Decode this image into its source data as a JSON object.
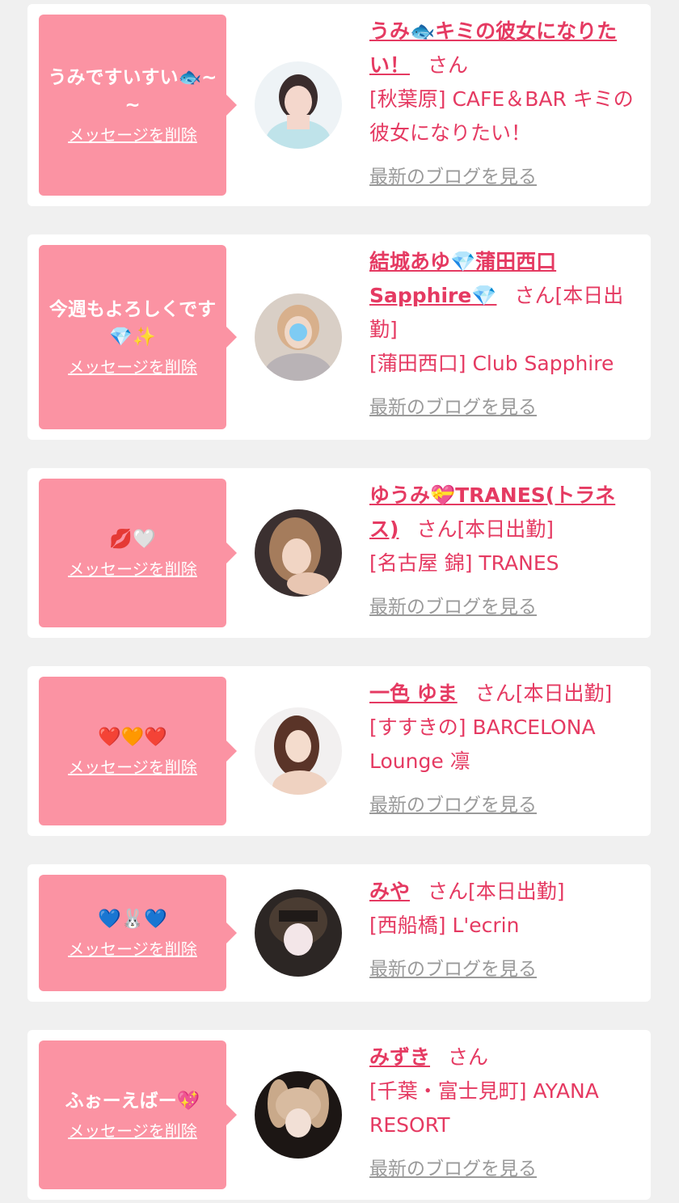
{
  "colors": {
    "background": "#f0f0f0",
    "card": "#ffffff",
    "bubble": "#fb93a3",
    "accent_text": "#e53a62",
    "link_gray": "#9a9a9a"
  },
  "items": [
    {
      "message": "うみですいすい🐟~~",
      "delete_label": "メッセージを削除",
      "name": "うみ🐟キミの彼女になりたい！",
      "honorific": "さん",
      "status": "",
      "shop": "[秋葉原] CAFE＆BAR キミの彼女になりたい！",
      "blog_label": "最新のブログを見る",
      "avatar_icon": "avatar-photo"
    },
    {
      "message": "今週もよろしくです💎✨",
      "delete_label": "メッセージを削除",
      "name": "結城あゆ💎蒲田西口Sapphire💎",
      "honorific": "さん",
      "status": "[本日出勤]",
      "shop": "[蒲田西口] Club Sapphire",
      "blog_label": "最新のブログを見る",
      "avatar_icon": "avatar-photo"
    },
    {
      "message": "💋🤍",
      "delete_label": "メッセージを削除",
      "name": "ゆうみ💝TRANES(トラネス)",
      "honorific": "さん",
      "status": "[本日出勤]",
      "shop": "[名古屋 錦] TRANES",
      "blog_label": "最新のブログを見る",
      "avatar_icon": "avatar-photo"
    },
    {
      "message": "❤️🧡❤️",
      "delete_label": "メッセージを削除",
      "name": "一色 ゆま",
      "honorific": "さん",
      "status": "[本日出勤]",
      "shop": "[すすきの] BARCELONA Lounge 凛",
      "blog_label": "最新のブログを見る",
      "avatar_icon": "avatar-photo"
    },
    {
      "message": "💙🐰💙",
      "delete_label": "メッセージを削除",
      "name": "みや",
      "honorific": "さん",
      "status": "[本日出勤]",
      "shop": "[西船橋] L'ecrin",
      "blog_label": "最新のブログを見る",
      "avatar_icon": "avatar-photo"
    },
    {
      "message": "ふぉーえばー💖",
      "delete_label": "メッセージを削除",
      "name": "みずき",
      "honorific": "さん",
      "status": "",
      "shop": "[千葉・富士見町] AYANA RESORT",
      "blog_label": "最新のブログを見る",
      "avatar_icon": "avatar-photo"
    }
  ]
}
